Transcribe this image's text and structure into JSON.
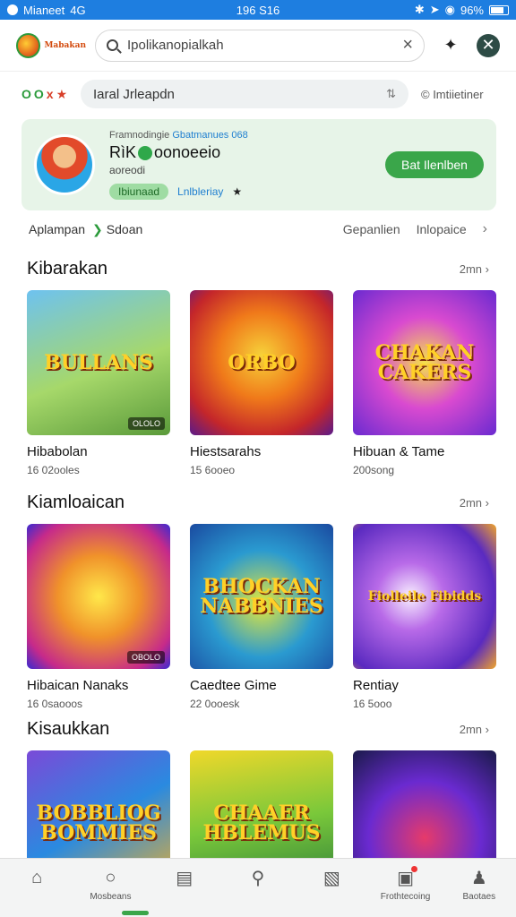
{
  "status_bar": {
    "carrier": "Mianeet",
    "network": "4G",
    "time": "196 S16",
    "battery": "96%"
  },
  "header": {
    "logo_text": "Mabakan",
    "search": {
      "value": "Ipolikanopialkah",
      "placeholder": "Search"
    },
    "icons": [
      "search-icon",
      "close-icon",
      "friends-icon",
      "compass-icon"
    ]
  },
  "filter": {
    "chips": [
      "O",
      "O",
      "x",
      "★"
    ],
    "input_value": "Iaral Jrleapdn",
    "right_text": "© Imtiietiner"
  },
  "profile": {
    "meta_prefix": "Framnodingie",
    "meta_highlight": "Gbatmanues 068",
    "name_prefix": "RìK",
    "name": "oonoeeio",
    "subtitle": "aoreodi",
    "badge": "Ibiunaad",
    "link": "Lnlbleriay",
    "follow_label": "Bat Ilenlben"
  },
  "tabs": {
    "left": "Aplampan",
    "left_extra": "Sdoan",
    "right1": "Gepanlien",
    "right2": "Inlopaice"
  },
  "sections": [
    {
      "title": "Kibarakan",
      "more": "2mn",
      "cards": [
        {
          "title_art": "BULLANS",
          "name": "Hibabolan",
          "count": "16 02ooles",
          "tag": "OLOLO",
          "colors": "g1"
        },
        {
          "title_art": "ORBO",
          "name": "Hiestsarahs",
          "count": "15 6ooeo",
          "tag": "",
          "colors": "g2"
        },
        {
          "title_art": "CHAKAN CAKERS",
          "name": "Hibuan & Tame",
          "count": "200song",
          "tag": "",
          "colors": "g3"
        }
      ]
    },
    {
      "title": "Kiamloaican",
      "more": "2mn",
      "cards": [
        {
          "title_art": "",
          "name": "Hibaican Nanaks",
          "count": "16 0saooos",
          "tag": "OBOLO",
          "colors": "g4"
        },
        {
          "title_art": "BHOCKAN NABBNIES",
          "name": "Caedtee Gime",
          "count": "22 0ooesk",
          "tag": "",
          "colors": "g5"
        },
        {
          "title_art": "Fiolleile Fibidds",
          "name": "Rentiay",
          "count": "16 5ooo",
          "tag": "",
          "colors": "g6"
        }
      ]
    },
    {
      "title": "Kisaukkan",
      "more": "2mn",
      "cards": [
        {
          "title_art": "BOBBLIOG BOMMIES",
          "name": "",
          "count": "",
          "tag": "",
          "colors": "g7"
        },
        {
          "title_art": "CHAAER HBLEMUS",
          "name": "",
          "count": "",
          "tag": "",
          "colors": "g8"
        },
        {
          "title_art": "",
          "name": "",
          "count": "",
          "tag": "",
          "colors": "g9"
        }
      ]
    }
  ],
  "bottom_nav": [
    {
      "label": "",
      "icon": "home-icon"
    },
    {
      "label": "Mosbeans",
      "icon": "chat-icon"
    },
    {
      "label": "",
      "icon": "list-icon"
    },
    {
      "label": "",
      "icon": "pin-icon"
    },
    {
      "label": "",
      "icon": "gift-icon"
    },
    {
      "label": "Frothtecoing",
      "icon": "camera-icon"
    },
    {
      "label": "Baotaes",
      "icon": "profile-icon"
    }
  ]
}
